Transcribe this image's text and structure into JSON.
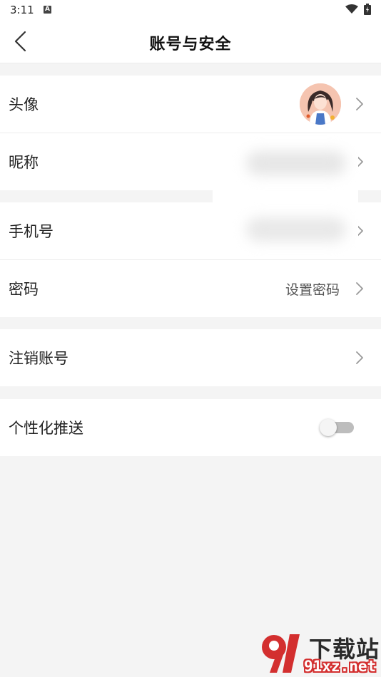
{
  "status_bar": {
    "time": "3:11",
    "notification_icon": "a-icon",
    "wifi_icon": "wifi-icon",
    "battery_icon": "battery-icon"
  },
  "header": {
    "title": "账号与安全",
    "back_icon": "chevron-left-icon"
  },
  "rows": {
    "avatar": {
      "label": "头像"
    },
    "nickname": {
      "label": "昵称",
      "value": ""
    },
    "phone": {
      "label": "手机号",
      "value": ""
    },
    "password": {
      "label": "密码",
      "value": "设置密码"
    },
    "cancel_account": {
      "label": "注销账号"
    },
    "personalized_push": {
      "label": "个性化推送",
      "enabled": false
    }
  },
  "watermark": {
    "text": "下载站",
    "url": "91xz.net"
  },
  "colors": {
    "background": "#f4f4f4",
    "row": "#ffffff",
    "chevron": "#999999",
    "toggle_off": "#bdbdbd",
    "watermark_red": "#d32f2f"
  }
}
